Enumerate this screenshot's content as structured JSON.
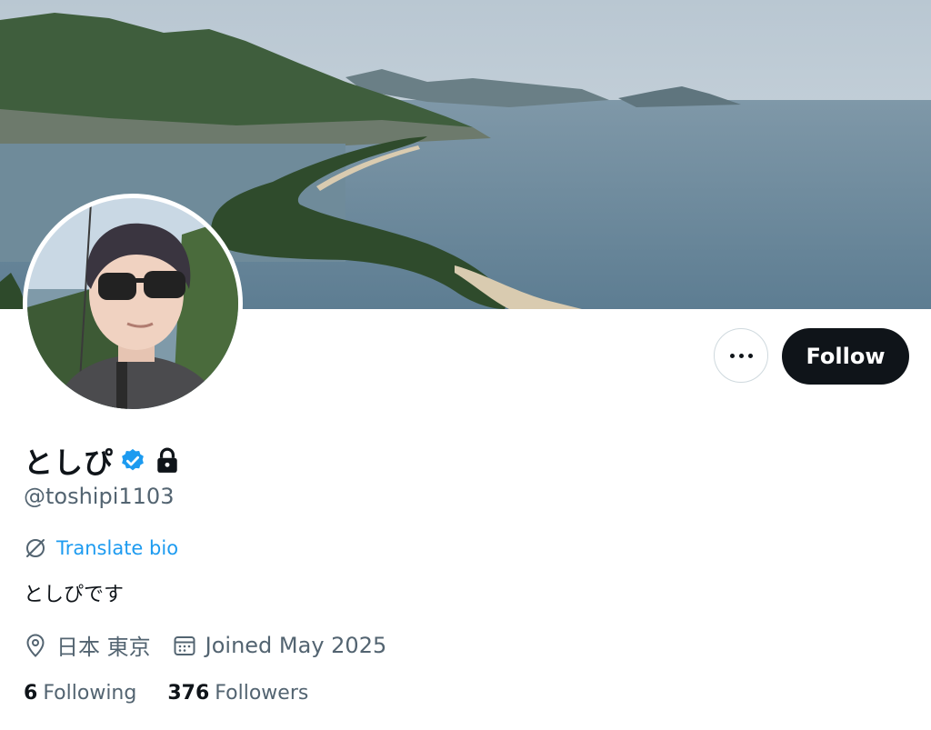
{
  "profile": {
    "display_name": "としぴ",
    "handle": "@toshipi1103",
    "translate_label": "Translate bio",
    "bio": "としぴです",
    "location": "日本 東京",
    "joined": "Joined May 2025",
    "following_count": "6",
    "following_label": "Following",
    "followers_count": "376",
    "followers_label": "Followers",
    "verified_badge": "verified-icon",
    "protected_badge": "lock-icon"
  },
  "actions": {
    "follow_label": "Follow",
    "more_icon": "ellipsis-icon"
  },
  "colors": {
    "accent": "#1d9bf0",
    "text_primary": "#0f1419",
    "text_secondary": "#536471",
    "follow_bg": "#0f1419"
  }
}
